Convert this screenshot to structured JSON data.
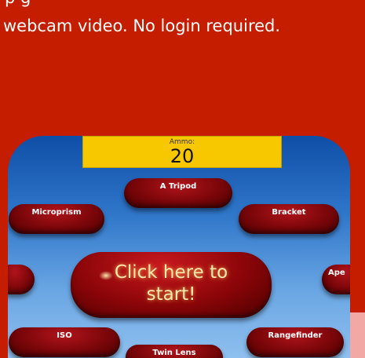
{
  "intro": {
    "line1": "p                                             g",
    "line2": "webcam video. No login required."
  },
  "game": {
    "ammo_label": "Ammo:",
    "ammo_value": "20",
    "start_label_line1": "Click here to",
    "start_label_line2": "start!",
    "targets": {
      "tripod": "A Tripod",
      "microprism": "Microprism",
      "bracket": "Bracket",
      "ape": "Ape",
      "iso": "ISO",
      "twin_lens": "Twin Lens",
      "rangefinder": "Rangefinder"
    }
  },
  "colors": {
    "page_background": "#c41d00",
    "ammo_bar": "#f7c700",
    "target_red": "#7a0609"
  }
}
